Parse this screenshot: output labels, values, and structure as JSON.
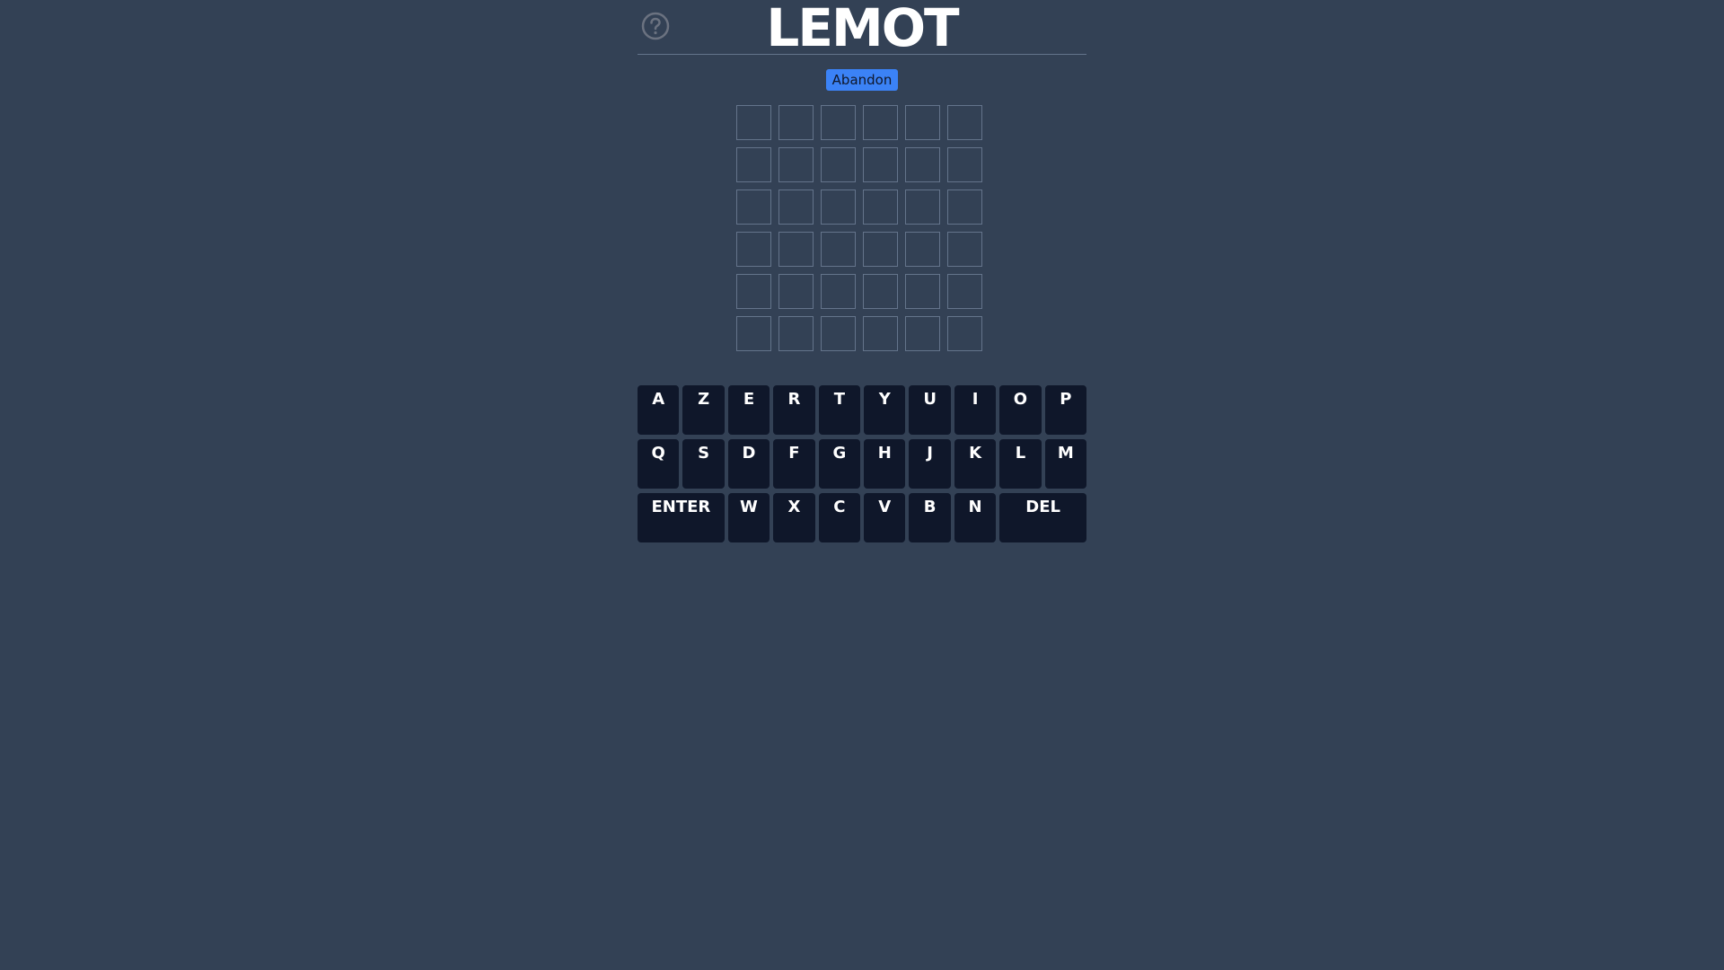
{
  "header": {
    "title": "LEMOT",
    "help_icon": "question-circle-icon"
  },
  "actions": {
    "abandon_label": "Abandon"
  },
  "grid": {
    "rows": 6,
    "cols": 6,
    "letters": [
      [
        "",
        "",
        "",
        "",
        "",
        ""
      ],
      [
        "",
        "",
        "",
        "",
        "",
        ""
      ],
      [
        "",
        "",
        "",
        "",
        "",
        ""
      ],
      [
        "",
        "",
        "",
        "",
        "",
        ""
      ],
      [
        "",
        "",
        "",
        "",
        "",
        ""
      ],
      [
        "",
        "",
        "",
        "",
        "",
        ""
      ]
    ]
  },
  "keyboard": {
    "rows": [
      [
        "A",
        "Z",
        "E",
        "R",
        "T",
        "Y",
        "U",
        "I",
        "O",
        "P"
      ],
      [
        "Q",
        "S",
        "D",
        "F",
        "G",
        "H",
        "J",
        "K",
        "L",
        "M"
      ],
      [
        "ENTER",
        "W",
        "X",
        "C",
        "V",
        "B",
        "N",
        "DEL"
      ]
    ]
  },
  "colors": {
    "background": "#334155",
    "key": "#0f172a",
    "accent": "#3b82f6",
    "cell_border": "#64748b"
  }
}
